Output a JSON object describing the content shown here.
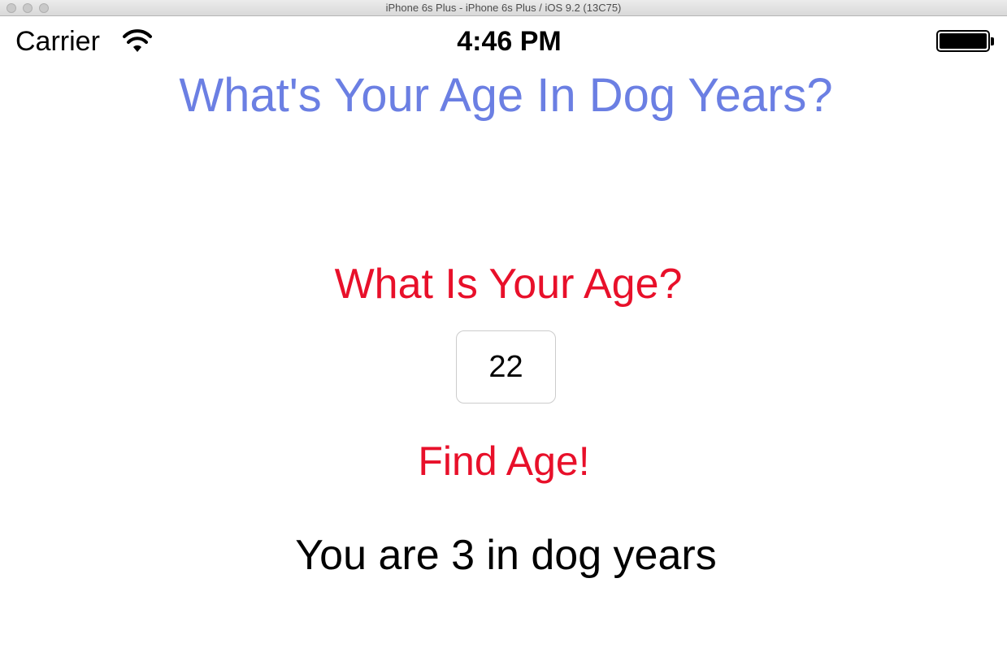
{
  "window": {
    "title": "iPhone 6s Plus - iPhone 6s Plus / iOS 9.2 (13C75)"
  },
  "status_bar": {
    "carrier": "Carrier",
    "time": "4:46 PM",
    "wifi_icon": "wifi-icon",
    "battery_icon": "battery-icon"
  },
  "app": {
    "heading": "What's Your Age In Dog Years?",
    "prompt": "What Is Your Age?",
    "age_input_value": "22",
    "find_button_label": "Find Age!",
    "result_text": "You are 3 in dog years"
  },
  "colors": {
    "heading": "#6b7fe3",
    "accent_red": "#e8102a",
    "text": "#000000"
  }
}
